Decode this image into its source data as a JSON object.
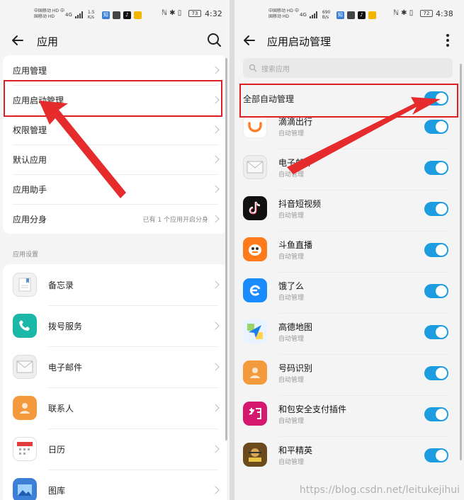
{
  "status_left": {
    "carrier": "中国移动 HD 中国移动 HD",
    "net": "4G",
    "speed": "1.5 K/s",
    "battery": "73",
    "time": "4:32"
  },
  "status_right": {
    "carrier": "中国移动 HD 中国移动 HD",
    "net": "4G",
    "speed": "690 B/s",
    "battery": "72",
    "time": "4:38"
  },
  "left": {
    "title": "应用",
    "menu": [
      {
        "label": "应用管理"
      },
      {
        "label": "应用启动管理"
      },
      {
        "label": "权限管理"
      },
      {
        "label": "默认应用"
      },
      {
        "label": "应用助手"
      },
      {
        "label": "应用分身",
        "extra": "已有 1 个应用开启分身"
      }
    ],
    "section_title": "应用设置",
    "apps": [
      {
        "label": "备忘录",
        "icon": "memo-icon",
        "color": "#f2f2f2"
      },
      {
        "label": "拨号服务",
        "icon": "phone-icon",
        "color": "#1bb8a8"
      },
      {
        "label": "电子邮件",
        "icon": "mail-icon",
        "color": "#eeeeee"
      },
      {
        "label": "联系人",
        "icon": "contacts-icon",
        "color": "#f39a3c"
      },
      {
        "label": "日历",
        "icon": "calendar-icon",
        "color": "#ffffff"
      },
      {
        "label": "图库",
        "icon": "gallery-icon",
        "color": "#3b7fd6"
      }
    ]
  },
  "right": {
    "title": "应用启动管理",
    "search_placeholder": "搜索应用",
    "all_label": "全部自动管理",
    "apps": [
      {
        "name": "滴滴出行",
        "sub": "自动管理",
        "icon": "didi-icon",
        "color": "#ffffff"
      },
      {
        "name": "电子邮件",
        "sub": "自动管理",
        "icon": "mail-icon",
        "color": "#eeeeee"
      },
      {
        "name": "抖音短视频",
        "sub": "自动管理",
        "icon": "tiktok-icon",
        "color": "#111111"
      },
      {
        "name": "斗鱼直播",
        "sub": "自动管理",
        "icon": "douyu-icon",
        "color": "#ff7a1a"
      },
      {
        "name": "饿了么",
        "sub": "自动管理",
        "icon": "eleme-icon",
        "color": "#1a8cff"
      },
      {
        "name": "高德地图",
        "sub": "自动管理",
        "icon": "amap-icon",
        "color": "#e8f3ff"
      },
      {
        "name": "号码识别",
        "sub": "自动管理",
        "icon": "callerid-icon",
        "color": "#f39a3c"
      },
      {
        "name": "和包安全支付插件",
        "sub": "自动管理",
        "icon": "hebao-icon",
        "color": "#d6186f"
      },
      {
        "name": "和平精英",
        "sub": "自动管理",
        "icon": "pubg-icon",
        "color": "#6b4a1e"
      }
    ]
  },
  "watermark": "https://blog.csdn.net/leitukejihui",
  "accent": "#1b9de0",
  "annotation_color": "#e02020"
}
